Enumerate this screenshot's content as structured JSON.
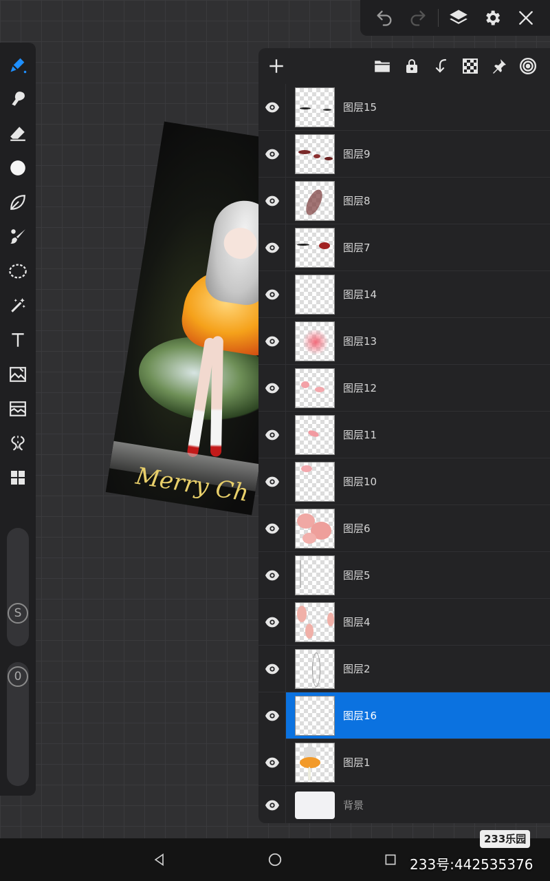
{
  "app": {
    "accent": "#0b72e0"
  },
  "topbar": {
    "undo_icon": "undo-icon",
    "redo_icon": "redo-icon",
    "layers_icon": "layers-icon",
    "settings_icon": "gear-icon",
    "close_icon": "close-icon"
  },
  "toolbar": {
    "tools": [
      "brush",
      "smudge",
      "eraser",
      "color",
      "liquify",
      "blend-brush",
      "lasso",
      "magic-wand",
      "text",
      "image-transform",
      "adjust",
      "symmetry",
      "more"
    ],
    "size_knob_label": "S",
    "opacity_knob_label": "0"
  },
  "artwork": {
    "caption": "Merry Ch"
  },
  "layers": [
    {
      "name": "图层15"
    },
    {
      "name": "图层9"
    },
    {
      "name": "图层8"
    },
    {
      "name": "图层7"
    },
    {
      "name": "图层14"
    },
    {
      "name": "图层13"
    },
    {
      "name": "图层12"
    },
    {
      "name": "图层11"
    },
    {
      "name": "图层10"
    },
    {
      "name": "图层6"
    },
    {
      "name": "图层5"
    },
    {
      "name": "图层4"
    },
    {
      "name": "图层2"
    },
    {
      "name": "图层16",
      "selected": true
    },
    {
      "name": "图层1"
    },
    {
      "name": "背景"
    }
  ],
  "watermark": {
    "logo": "233乐园",
    "text": "233号:442535376"
  }
}
